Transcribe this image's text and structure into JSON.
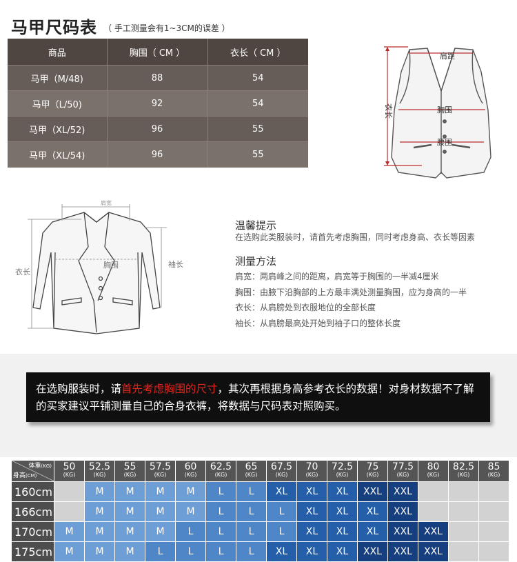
{
  "title": "马甲尺码表",
  "subtitle": "（ 手工测量会有1~3CM的误差 ）",
  "vest_table": {
    "headers": [
      "商品",
      "胸围（ CM ）",
      "衣长（ CM ）"
    ],
    "rows": [
      [
        "马甲（M/48)",
        "88",
        "54"
      ],
      [
        "马甲（L/50)",
        "92",
        "54"
      ],
      [
        "马甲（XL/52)",
        "96",
        "55"
      ],
      [
        "马甲（XL/54)",
        "96",
        "55"
      ]
    ]
  },
  "vest_diagram": {
    "shoulder": "肩距",
    "chest": "胸围",
    "waist": "腰围",
    "length": "衣长"
  },
  "jacket_diagram": {
    "shoulder": "肩宽",
    "chest": "胸围",
    "sleeve": "袖长",
    "length": "衣长"
  },
  "tips": {
    "heading1": "温馨提示",
    "tip": "在选购此类服装时，请首先考虑胸围，同时考虑身高、衣长等因素",
    "heading2": "测量方法",
    "methods": [
      "肩宽：两肩峰之间的距离，肩宽等于胸围的一半减4厘米",
      "胸围：由腋下沿胸部的上方最丰满处测量胸围，应为身高的一半",
      "衣长：从肩膀处到衣服地位的全部长度",
      "袖长：从肩膀最高处开始到袖子口的整体长度"
    ]
  },
  "banner": {
    "part1": "在选购服装时，请",
    "highlight": "首先考虑胸围的尺寸",
    "part2": "，其次再根据身高参考衣长的数据！对身材数据不了解的买家建议平铺测量自己的合身衣裤，将数据与尺码表对照购买。"
  },
  "size_chart": {
    "weight_label": "体重",
    "weight_unit": "(KG)",
    "height_label": "身高",
    "height_unit": "(CM)",
    "weights": [
      "50",
      "52.5",
      "55",
      "57.5",
      "60",
      "62.5",
      "65",
      "67.5",
      "70",
      "72.5",
      "75",
      "77.5",
      "80",
      "82.5",
      "85"
    ],
    "kg": "(KG)",
    "rows": [
      {
        "height": "160cm",
        "sizes": [
          "",
          "M",
          "M",
          "M",
          "M",
          "L",
          "L",
          "XL",
          "XL",
          "XL",
          "XXL",
          "XXL",
          "",
          "",
          ""
        ]
      },
      {
        "height": "166cm",
        "sizes": [
          "",
          "M",
          "M",
          "M",
          "M",
          "L",
          "L",
          "L",
          "XL",
          "XL",
          "XL",
          "XXL",
          "",
          "",
          ""
        ]
      },
      {
        "height": "170cm",
        "sizes": [
          "M",
          "M",
          "M",
          "M",
          "L",
          "L",
          "L",
          "L",
          "XL",
          "XL",
          "XL",
          "XXL",
          "XXL",
          "",
          ""
        ]
      },
      {
        "height": "175cm",
        "sizes": [
          "M",
          "M",
          "M",
          "L",
          "L",
          "L",
          "L",
          "XL",
          "XL",
          "XL",
          "XXL",
          "XXL",
          "XXL",
          "",
          ""
        ]
      }
    ]
  }
}
